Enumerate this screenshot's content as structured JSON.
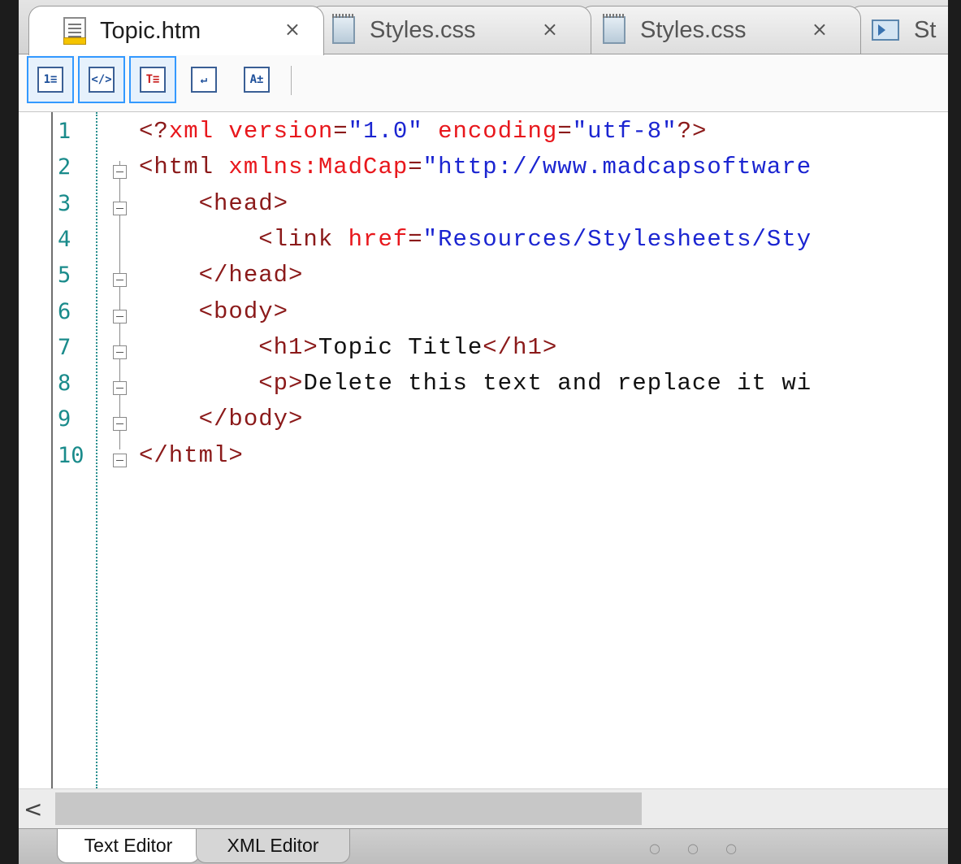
{
  "tabs": [
    {
      "label": "Topic.htm",
      "icon": "document-icon",
      "close": "×",
      "active": true
    },
    {
      "label": "Styles.css",
      "icon": "stylesheet-icon",
      "close": "×",
      "active": false
    },
    {
      "label": "Styles.css",
      "icon": "stylesheet-icon",
      "close": "×",
      "active": false
    },
    {
      "label": "St",
      "icon": "skin-icon",
      "close": "",
      "active": false
    }
  ],
  "toolbar": {
    "buttons": [
      {
        "name": "line-numbers-button",
        "glyph": "1≡",
        "selected": true
      },
      {
        "name": "tag-view-button",
        "glyph": "</>",
        "selected": true
      },
      {
        "name": "outline-button",
        "glyph": "T≡",
        "selected": true
      },
      {
        "name": "word-wrap-button",
        "glyph": "↵",
        "selected": false
      },
      {
        "name": "font-size-button",
        "glyph": "A±",
        "selected": false
      }
    ]
  },
  "editor": {
    "lines": [
      {
        "num": "1",
        "fold": false,
        "tokens": [
          [
            "br",
            "<?"
          ],
          [
            "attr",
            "xml"
          ],
          [
            "attr",
            " version"
          ],
          [
            "br",
            "="
          ],
          [
            "val",
            "\"1.0\""
          ],
          [
            "attr",
            " encoding"
          ],
          [
            "br",
            "="
          ],
          [
            "val",
            "\"utf-8\""
          ],
          [
            "br",
            "?>"
          ]
        ]
      },
      {
        "num": "2",
        "fold": true,
        "tokens": [
          [
            "br",
            "<html "
          ],
          [
            "attr",
            "xmlns:MadCap"
          ],
          [
            "br",
            "="
          ],
          [
            "val",
            "\"http://www.madcapsoftware"
          ]
        ]
      },
      {
        "num": "3",
        "fold": true,
        "tokens": [
          [
            "br",
            "    <head>"
          ]
        ]
      },
      {
        "num": "4",
        "fold": false,
        "tokens": [
          [
            "br",
            "        <link "
          ],
          [
            "attr",
            "href"
          ],
          [
            "br",
            "="
          ],
          [
            "val",
            "\"Resources/Stylesheets/Sty"
          ]
        ]
      },
      {
        "num": "5",
        "fold": true,
        "tokens": [
          [
            "br",
            "    </head>"
          ]
        ]
      },
      {
        "num": "6",
        "fold": true,
        "tokens": [
          [
            "br",
            "    <body>"
          ]
        ]
      },
      {
        "num": "7",
        "fold": true,
        "tokens": [
          [
            "br",
            "        <h1>"
          ],
          [
            "txt",
            "Topic Title"
          ],
          [
            "br",
            "</h1>"
          ]
        ]
      },
      {
        "num": "8",
        "fold": true,
        "tokens": [
          [
            "br",
            "        <p>"
          ],
          [
            "txt",
            "Delete this text and replace it wi"
          ]
        ]
      },
      {
        "num": "9",
        "fold": true,
        "tokens": [
          [
            "br",
            "    </body>"
          ]
        ]
      },
      {
        "num": "10",
        "fold": true,
        "tokens": [
          [
            "br",
            "</html>"
          ]
        ]
      }
    ]
  },
  "scrollbar": {
    "left_arrow": "<"
  },
  "bottom_tabs": [
    {
      "label": "Text Editor",
      "active": true
    },
    {
      "label": "XML Editor",
      "active": false
    }
  ],
  "pager_dots": "○ ○ ○"
}
